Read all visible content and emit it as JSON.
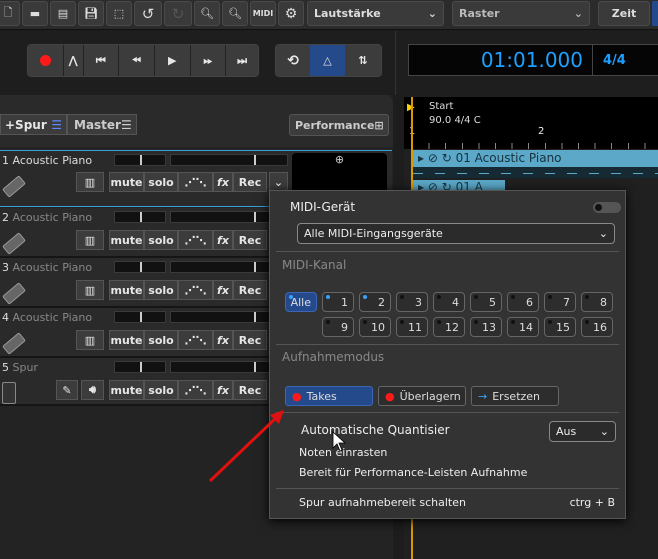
{
  "toolbar": {
    "icons": [
      "new-file-icon",
      "open-folder-icon",
      "import-icon",
      "save-icon",
      "selection-icon",
      "undo-icon",
      "redo-icon",
      "zoom-in-icon",
      "zoom-out-icon",
      "midi-icon",
      "settings-icon"
    ],
    "midi_label": "MIDI",
    "volume_select": "Lautstärke",
    "grid_select": "Raster",
    "time_button": "Zeit"
  },
  "transport": {
    "time": "01:01.000",
    "signature": "4/4"
  },
  "tracks_header": {
    "add_track": "+Spur",
    "master": "Master",
    "performance": "Performance"
  },
  "track_buttons": {
    "mute": "mute",
    "solo": "solo",
    "fx": "fx",
    "rec": "Rec"
  },
  "tracks": [
    {
      "num": "1",
      "name": "Acoustic Piano"
    },
    {
      "num": "2",
      "name": "Acoustic Piano"
    },
    {
      "num": "3",
      "name": "Acoustic Piano"
    },
    {
      "num": "4",
      "name": "Acoustic Piano"
    },
    {
      "num": "5",
      "name": "Spur"
    }
  ],
  "arrange": {
    "marker": "Start",
    "tempo": "90.0 4/4 C",
    "bar1": "1",
    "bar2": "2",
    "clip1": "01 Acoustic Piano",
    "clip2": "01 A"
  },
  "popup": {
    "device_title": "MIDI-Gerät",
    "device_value": "Alle MIDI-Eingangsgeräte",
    "channel_title": "MIDI-Kanal",
    "channel_all": "Alle",
    "channels": [
      "1",
      "2",
      "3",
      "4",
      "5",
      "6",
      "7",
      "8",
      "9",
      "10",
      "11",
      "12",
      "13",
      "14",
      "15",
      "16"
    ],
    "active_channels": [
      "1",
      "2"
    ],
    "mode_title": "Aufnahmemodus",
    "modes": [
      "Takes",
      "Überlagern",
      "Ersetzen"
    ],
    "selected_mode": "Takes",
    "auto_quant": "Automatische Quantisier",
    "auto_quant_value": "Aus",
    "snap": "Noten einrasten",
    "performance_ready": "Bereit für Performance-Leisten Aufnahme",
    "arm": "Spur aufnahmebereit schalten",
    "arm_shortcut": "ctrg + B"
  },
  "colors": {
    "accent": "#254a8c",
    "time": "#1ea0ff",
    "clip": "#5ba8c8",
    "record": "#ff1a1a"
  }
}
